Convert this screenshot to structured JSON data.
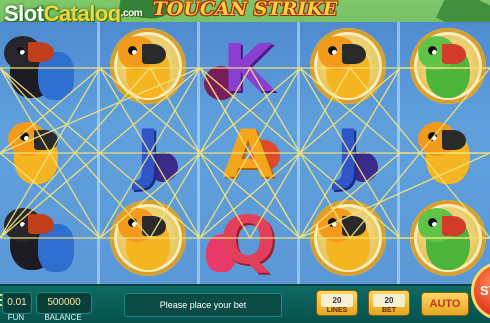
{
  "header": {
    "site_logo_main": "Slot",
    "site_logo_accent": "Catalog",
    "site_logo_suffix": ".com",
    "game_title": "TOUCAN STRIKE"
  },
  "reels": {
    "columns": [
      [
        "black toucan",
        "yellow parrot",
        "black toucan"
      ],
      [
        "yellow parrot",
        "J",
        "yellow parrot"
      ],
      [
        "K",
        "A",
        "Q"
      ],
      [
        "yellow parrot",
        "J",
        "yellow parrot"
      ],
      [
        "green parrot",
        "yellow parrot",
        "green parrot"
      ]
    ]
  },
  "bottom_bar": {
    "coin_value": "0.01",
    "coin_label": "FUN",
    "balance_value": "500000",
    "balance_label": "BALANCE",
    "message": "Please place your bet",
    "lines_value": "20",
    "lines_label": "LINES",
    "bet_value": "20",
    "bet_label": "BET",
    "auto_label": "AUTO",
    "spin_label": "ST"
  },
  "colors": {
    "accent": "#ffd763",
    "bar": "#06504b",
    "sky": "#5a98d6",
    "letter_K": "#8a3fd0",
    "letter_J": "#2f55c8",
    "letter_A": "#f4a51c",
    "letter_Q": "#e2405a"
  }
}
